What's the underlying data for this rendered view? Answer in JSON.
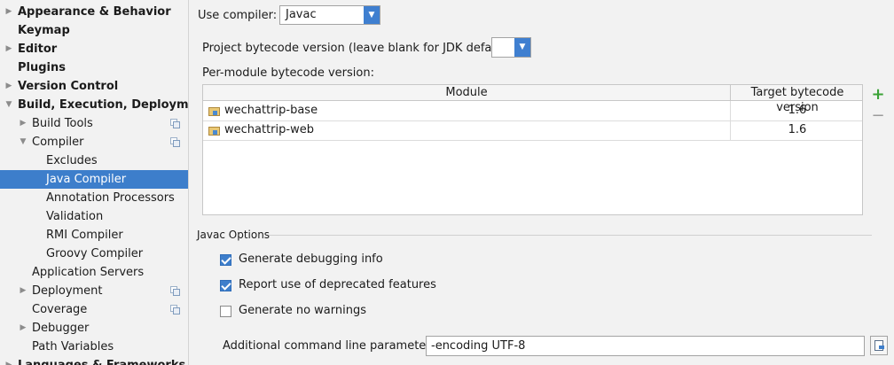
{
  "sidebar": {
    "items": [
      {
        "label": "Appearance & Behavior",
        "bold": true,
        "arrow": "collapsed"
      },
      {
        "label": "Keymap",
        "bold": true,
        "arrow": "none"
      },
      {
        "label": "Editor",
        "bold": true,
        "arrow": "collapsed"
      },
      {
        "label": "Plugins",
        "bold": true,
        "arrow": "none"
      },
      {
        "label": "Version Control",
        "bold": true,
        "arrow": "collapsed"
      },
      {
        "label": "Build, Execution, Deployment",
        "bold": true,
        "arrow": "expanded"
      },
      {
        "label": "Build Tools",
        "bold": false,
        "arrow": "collapsed",
        "project_icon": true
      },
      {
        "label": "Compiler",
        "bold": false,
        "arrow": "expanded",
        "project_icon": true
      },
      {
        "label": "Excludes",
        "bold": false,
        "arrow": "none"
      },
      {
        "label": "Java Compiler",
        "bold": false,
        "arrow": "none",
        "selected": true
      },
      {
        "label": "Annotation Processors",
        "bold": false,
        "arrow": "none"
      },
      {
        "label": "Validation",
        "bold": false,
        "arrow": "none"
      },
      {
        "label": "RMI Compiler",
        "bold": false,
        "arrow": "none"
      },
      {
        "label": "Groovy Compiler",
        "bold": false,
        "arrow": "none"
      },
      {
        "label": "Application Servers",
        "bold": false,
        "arrow": "none"
      },
      {
        "label": "Deployment",
        "bold": false,
        "arrow": "collapsed",
        "project_icon": true
      },
      {
        "label": "Coverage",
        "bold": false,
        "arrow": "none",
        "project_icon": true
      },
      {
        "label": "Debugger",
        "bold": false,
        "arrow": "collapsed"
      },
      {
        "label": "Path Variables",
        "bold": false,
        "arrow": "none"
      },
      {
        "label": "Languages & Frameworks",
        "bold": true,
        "arrow": "collapsed"
      }
    ]
  },
  "compiler": {
    "use_compiler_label": "Use compiler:",
    "use_compiler_value": "Javac",
    "bytecode_label": "Project bytecode version (leave blank for JDK default):",
    "bytecode_value": "",
    "per_module_label": "Per-module bytecode version:"
  },
  "table": {
    "headers": {
      "module": "Module",
      "target": "Target bytecode version"
    },
    "rows": [
      {
        "module": "wechattrip-base",
        "target": "1.6"
      },
      {
        "module": "wechattrip-web",
        "target": "1.6"
      }
    ],
    "add_icon": "+",
    "remove_icon": "−"
  },
  "javac": {
    "group_title": "Javac Options",
    "options": [
      {
        "label": "Generate debugging info",
        "checked": true
      },
      {
        "label": "Report use of deprecated features",
        "checked": true
      },
      {
        "label": "Generate no warnings",
        "checked": false
      }
    ],
    "params_label": "Additional command line parameters:",
    "params_value": "-encoding UTF-8"
  },
  "colors": {
    "selection": "#3d7ecb",
    "add_green": "#3aa236"
  }
}
